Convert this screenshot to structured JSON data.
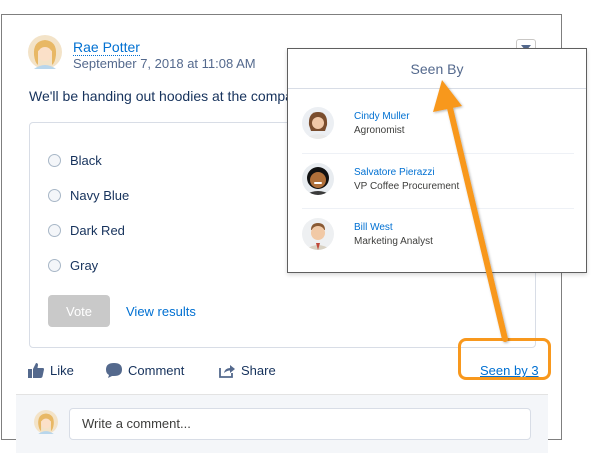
{
  "post": {
    "author": "Rae Potter",
    "timestamp": "September 7, 2018 at 11:08 AM",
    "body": "We'll be handing out hoodies at the compa"
  },
  "poll": {
    "options": [
      "Black",
      "Navy Blue",
      "Dark Red",
      "Gray"
    ],
    "vote_label": "Vote",
    "view_results_label": "View results"
  },
  "actions": {
    "like": "Like",
    "comment": "Comment",
    "share": "Share",
    "seen_by": "Seen by 3"
  },
  "comment_box": {
    "placeholder": "Write a comment..."
  },
  "seen_popup": {
    "title": "Seen By",
    "viewers": [
      {
        "name": "Cindy Muller",
        "title": "Agronomist"
      },
      {
        "name": "Salvatore Pierazzi",
        "title": "VP Coffee Procurement"
      },
      {
        "name": "Bill West",
        "title": "Marketing Analyst"
      }
    ]
  },
  "colors": {
    "link": "#0070d2",
    "callout": "#f8981d",
    "vote_disabled": "#c9c9c9"
  }
}
